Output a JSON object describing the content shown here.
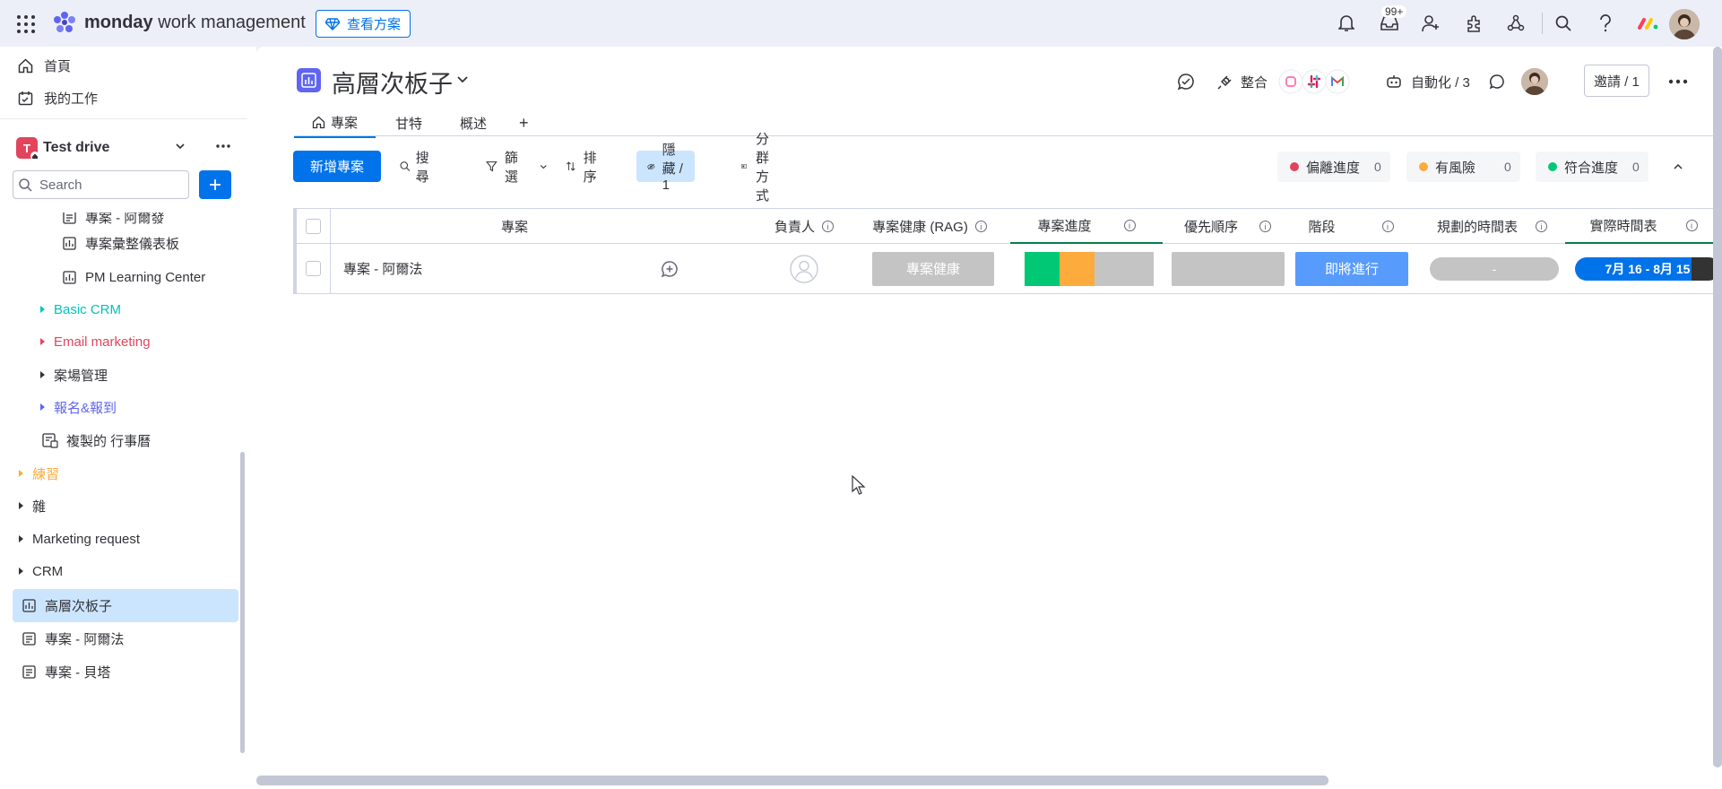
{
  "topbar": {
    "brand_bold": "monday",
    "brand_rest": " work management",
    "plans_label": "查看方案",
    "inbox_badge": "99+"
  },
  "sidebar": {
    "home": "首頁",
    "my_work": "我的工作",
    "workspace_name": "Test drive",
    "workspace_initial": "T",
    "search_placeholder": "Search",
    "tree": [
      {
        "label": "專案 - 阿爾發",
        "type": "board"
      },
      {
        "label": "專案彙整儀表板",
        "type": "dashboard"
      },
      {
        "label": "PM Learning Center",
        "type": "dashboard"
      },
      {
        "label": "Basic CRM",
        "type": "folder",
        "color": "#00c2bd"
      },
      {
        "label": "Email marketing",
        "type": "folder",
        "color": "#e2445c"
      },
      {
        "label": "案場管理",
        "type": "folder",
        "color": "#323338"
      },
      {
        "label": "報名&報到",
        "type": "folder",
        "color": "#5f65f0"
      },
      {
        "label": "複製的 行事曆",
        "type": "board"
      },
      {
        "label": "練習",
        "type": "folder",
        "color": "#fdab3d"
      },
      {
        "label": "雜",
        "type": "folder",
        "color": "#323338"
      },
      {
        "label": "Marketing request",
        "type": "folder",
        "color": "#323338"
      },
      {
        "label": "CRM",
        "type": "folder",
        "color": "#323338"
      },
      {
        "label": "高層次板子",
        "type": "dashboard",
        "active": true
      },
      {
        "label": "專案 - 阿爾法",
        "type": "board"
      },
      {
        "label": "專案 - 貝塔",
        "type": "board"
      }
    ]
  },
  "board": {
    "title": "高層次板子",
    "integrate_label": "整合",
    "automation_label": "自動化 / 3",
    "invite_label": "邀請 / 1",
    "tabs": [
      "專案",
      "甘特",
      "概述"
    ],
    "add_tab": "+"
  },
  "toolbar": {
    "new_item": "新增專案",
    "search": "搜尋",
    "filter": "篩選",
    "sort": "排序",
    "hide": "隱藏 / 1",
    "group_by": "分群方式"
  },
  "pills": [
    {
      "label": "偏離進度",
      "count": "0",
      "color": "#e2445c"
    },
    {
      "label": "有風險",
      "count": "0",
      "color": "#fdab3d"
    },
    {
      "label": "符合進度",
      "count": "0",
      "color": "#00c875"
    }
  ],
  "table": {
    "columns": [
      "專案",
      "負責人",
      "專案健康 (RAG)",
      "專案進度",
      "優先順序",
      "階段",
      "規劃的時間表",
      "實際時間表"
    ],
    "rows": [
      {
        "name": "專案 - 阿爾法",
        "health": "專案健康",
        "progress": [
          0.27,
          0.27,
          0.46
        ],
        "priority": "",
        "stage": "即將進行",
        "planned": "-",
        "actual": "7月 16 - 8月 15",
        "actual_elapsed": 0.8
      }
    ]
  },
  "colors": {
    "primary": "#0073ea",
    "green": "#00c875",
    "orange": "#fdab3d",
    "grey": "#c4c4c4",
    "blue_status": "#579bfc",
    "dark": "#333333"
  }
}
